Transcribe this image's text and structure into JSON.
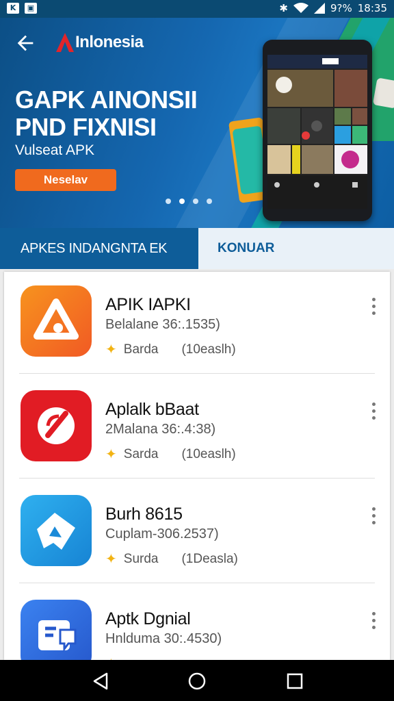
{
  "status": {
    "battery": "9?%",
    "time": "18:35"
  },
  "header": {
    "brand": "Inlonesia"
  },
  "hero": {
    "title_line1": "GAPK AINONSII",
    "title_line2": "PND FIXNISI",
    "subtitle": "Vulseat APK",
    "button": "Neselav"
  },
  "tabs": [
    {
      "label": "APKES INDANGNTA EK"
    },
    {
      "label": "KONUAR"
    }
  ],
  "apps": [
    {
      "title": "APIK IAPKI",
      "subtitle": "Belalane 36:.1535)",
      "rating": "Barda",
      "count": "(10easlh)",
      "color": "#f26a21"
    },
    {
      "title": "Aplalk bBaat",
      "subtitle": "2Malana 36:.4:38)",
      "rating": "Sarda",
      "count": "(10easlh)",
      "color": "#e11c24"
    },
    {
      "title": "Burh 8615",
      "subtitle": "Cuplam-306.2537)",
      "rating": "Surda",
      "count": "(1Deasla)",
      "color": "#1a9be3"
    },
    {
      "title": "Aptk Dgnial",
      "subtitle": "Hnlduma 30:.4530)",
      "rating": "",
      "count": "",
      "color": "#2867d6"
    }
  ],
  "icons": [
    "back-arrow-icon",
    "brand-logo-icon",
    "bluetooth-icon",
    "wifi-icon",
    "signal-icon",
    "more-vert-icon",
    "star-icon",
    "nav-back-icon",
    "nav-home-icon",
    "nav-recents-icon"
  ]
}
